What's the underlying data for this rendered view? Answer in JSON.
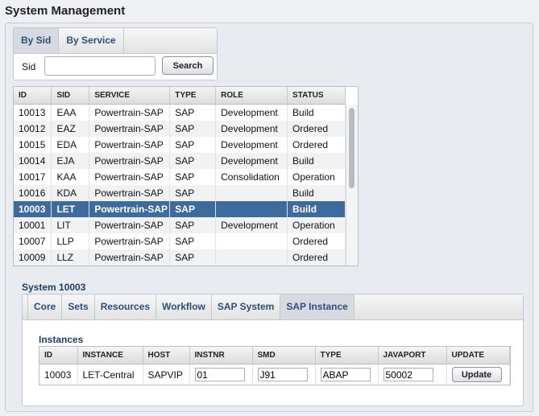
{
  "page_title": "System Management",
  "search": {
    "tabs": [
      {
        "label": "By Sid",
        "active": true
      },
      {
        "label": "By Service",
        "active": false
      }
    ],
    "sid_label": "Sid",
    "sid_value": "",
    "button": "Search"
  },
  "systems": {
    "columns": [
      "ID",
      "SID",
      "SERVICE",
      "TYPE",
      "ROLE",
      "STATUS"
    ],
    "rows": [
      [
        "10013",
        "EAA",
        "Powertrain-SAP",
        "SAP",
        "Development",
        "Build"
      ],
      [
        "10012",
        "EAZ",
        "Powertrain-SAP",
        "SAP",
        "Development",
        "Ordered"
      ],
      [
        "10015",
        "EDA",
        "Powertrain-SAP",
        "SAP",
        "Development",
        "Ordered"
      ],
      [
        "10014",
        "EJA",
        "Powertrain-SAP",
        "SAP",
        "Development",
        "Build"
      ],
      [
        "10017",
        "KAA",
        "Powertrain-SAP",
        "SAP",
        "Consolidation",
        "Operation"
      ],
      [
        "10016",
        "KDA",
        "Powertrain-SAP",
        "SAP",
        "",
        "Build"
      ],
      [
        "10003",
        "LET",
        "Powertrain-SAP",
        "SAP",
        "",
        "Build"
      ],
      [
        "10001",
        "LIT",
        "Powertrain-SAP",
        "SAP",
        "Development",
        "Operation"
      ],
      [
        "10007",
        "LLP",
        "Powertrain-SAP",
        "SAP",
        "",
        "Ordered"
      ],
      [
        "10009",
        "LLZ",
        "Powertrain-SAP",
        "SAP",
        "",
        "Ordered"
      ]
    ],
    "selected_index": 6
  },
  "detail": {
    "title": "System 10003",
    "tabs": [
      {
        "label": "Core",
        "active": false
      },
      {
        "label": "Sets",
        "active": false
      },
      {
        "label": "Resources",
        "active": false
      },
      {
        "label": "Workflow",
        "active": false
      },
      {
        "label": "SAP System",
        "active": false
      },
      {
        "label": "SAP Instance",
        "active": true
      }
    ],
    "instances_title": "Instances",
    "columns": [
      "ID",
      "INSTANCE",
      "HOST",
      "INSTNR",
      "SMD",
      "TYPE",
      "JAVAPORT",
      "UPDATE"
    ],
    "row": {
      "id": "10003",
      "instance": "LET-Central",
      "host": "SAPVIP",
      "instnr": "01",
      "smd": "J91",
      "type": "ABAP",
      "javaport": "50002",
      "update_label": "Update"
    }
  }
}
